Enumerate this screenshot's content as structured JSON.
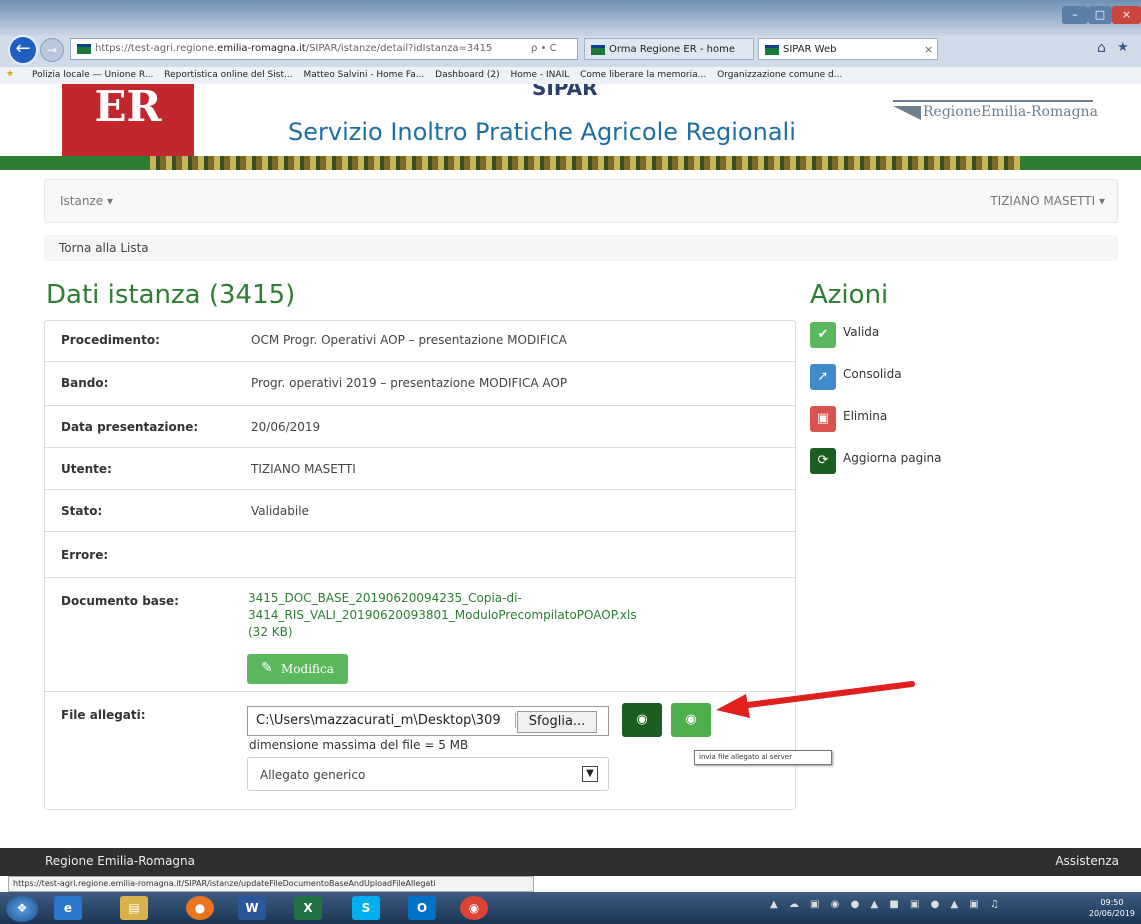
{
  "browser": {
    "url_prefix": "https://test-agri.regione.",
    "url_domain": "emilia-romagna.it",
    "url_path": "/SIPAR/istanze/detail?idIstanza=3415",
    "url_controls": "ρ • C",
    "tabs": [
      {
        "label": "Orma Regione ER - home"
      },
      {
        "label": "SIPAR Web"
      }
    ],
    "tab_close": "×",
    "bookmarks": [
      "Polizia locale — Unione R...",
      "Reportistica online del Sist...",
      "Matteo Salvini - Home Fa...",
      "Dashboard (2)",
      "Home - INAIL",
      "Come liberare la memoria...",
      "Organizzazione comune d..."
    ],
    "status_url": "https://test-agri.regione.emilia-romagna.it/SIPAR/istanze/updateFileDocumentoBaseAndUploadFileAllegati"
  },
  "header": {
    "logo_text": "ER",
    "top_cut_text": "SIPAR",
    "site_title": "Servizio Inoltro Pratiche Agricole Regionali",
    "region_logo_text": "RegioneEmilia-Romagna"
  },
  "navbar": {
    "istanze": "Istanze ▾",
    "user": "TIZIANO MASETTI ▾"
  },
  "breadcrumb": "Torna alla Lista",
  "main": {
    "title": "Dati istanza (3415)",
    "rows": [
      {
        "label": "Procedimento:",
        "value": "OCM Progr. Operativi AOP – presentazione MODIFICA"
      },
      {
        "label": "Bando:",
        "value": "Progr. operativi 2019 – presentazione MODIFICA AOP"
      },
      {
        "label": "Data presentazione:",
        "value": "20/06/2019"
      },
      {
        "label": "Utente:",
        "value": "TIZIANO MASETTI"
      },
      {
        "label": "Stato:",
        "value": "Validabile"
      },
      {
        "label": "Errore:",
        "value": ""
      },
      {
        "label": "Documento base:",
        "value": ""
      },
      {
        "label": "File allegati:",
        "value": ""
      }
    ],
    "document": {
      "line1": "3415_DOC_BASE_20190620094235_Copia-di-",
      "line2": "3414_RIS_VALI_20190620093801_ModuloPrecompilatoPOAOP.xls",
      "size": "(32 KB)",
      "modify_label": "Modifica"
    },
    "attachments": {
      "file_path": "C:\\Users\\mazzacurati_m\\Desktop\\309",
      "browse_label": "Sfoglia...",
      "hint": "dimensione massima del file = 5 MB",
      "selected_type": "Allegato generico",
      "tooltip": "invia file allegato al server"
    }
  },
  "actions": {
    "title": "Azioni",
    "items": [
      {
        "label": "Valida",
        "icon": "check-icon",
        "color": "#5cb85c"
      },
      {
        "label": "Consolida",
        "icon": "pin-icon",
        "color": "#428bca"
      },
      {
        "label": "Elimina",
        "icon": "trash-icon",
        "color": "#d9534f"
      },
      {
        "label": "Aggiorna pagina",
        "icon": "refresh-icon",
        "color": "#1b5e20"
      }
    ]
  },
  "footer": {
    "left": "Regione Emilia-Romagna",
    "right": "Assistenza"
  },
  "taskbar": {
    "time": "09:50",
    "date": "20/06/2019"
  },
  "colors": {
    "brand_green": "#2e7d32",
    "brand_red": "#c1272d",
    "title_blue": "#1c6f9f",
    "annotation_arrow": "#e0201e"
  }
}
